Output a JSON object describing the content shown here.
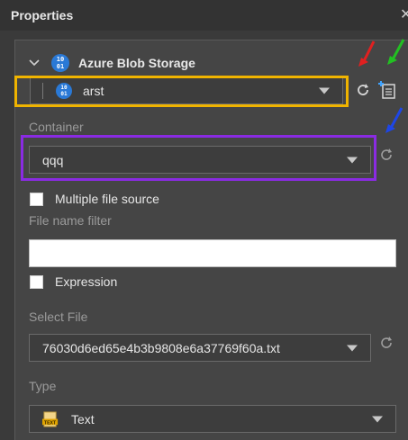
{
  "window": {
    "title": "Properties"
  },
  "section": {
    "title": "Azure Blob Storage",
    "icon": "blob-storage-icon"
  },
  "connection": {
    "value": "arst"
  },
  "container": {
    "label": "Container",
    "value": "qqq"
  },
  "multiple_file_source": {
    "label": "Multiple file source",
    "checked": false
  },
  "file_name_filter": {
    "label": "File name filter",
    "value": ""
  },
  "expression": {
    "label": "Expression",
    "checked": false
  },
  "select_file": {
    "label": "Select File",
    "value": "76030d6ed65e4b3b9808e6a37769f60a.txt"
  },
  "type": {
    "label": "Type",
    "value": "Text",
    "icon": "text-file-icon"
  },
  "annotations": {
    "connection_highlight_color": "#f0b400",
    "container_highlight_color": "#8a2be2",
    "arrows": [
      {
        "color": "#e02020",
        "target": "connection-refresh"
      },
      {
        "color": "#22c022",
        "target": "new-connection"
      },
      {
        "color": "#1e46e6",
        "target": "container-refresh"
      }
    ]
  }
}
